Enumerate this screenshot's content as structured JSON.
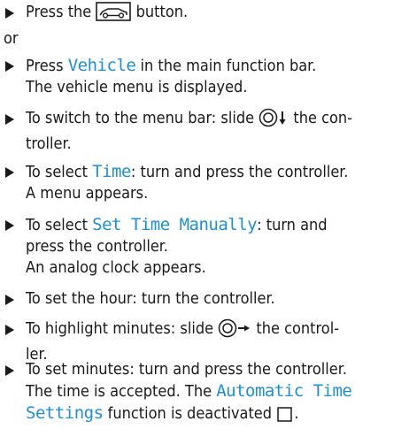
{
  "s1": {
    "a": "Press the",
    "b": "button."
  },
  "or": "or",
  "s2": {
    "a": "Press",
    "k": "Vehicle",
    "b": "in the main function bar.",
    "line2": "The vehicle menu is displayed."
  },
  "s3": {
    "a": "To switch to the menu bar: slide",
    "b": "the con-",
    "line2": "troller."
  },
  "s4": {
    "a": "To select",
    "k": "Time",
    "b": ": turn and press the controller.",
    "line2": "A menu appears."
  },
  "s5": {
    "a": "To select",
    "k": "Set Time Manually",
    "b": ": turn and",
    "line2": "press the controller.",
    "line3": "An analog clock appears."
  },
  "s6": {
    "a": "To set the hour: turn the controller."
  },
  "s7": {
    "a": "To highlight minutes: slide",
    "b": "the control-",
    "line2": "ler."
  },
  "s8": {
    "a": "To set minutes: turn and press the controller.",
    "line2a": "The time is accepted. The",
    "k1": "Automatic Time",
    "k2": "Settings",
    "line3b": "function is deactivated"
  },
  "colors": {
    "text": "#1a1a1a",
    "keyword": "#1e8fd6"
  }
}
